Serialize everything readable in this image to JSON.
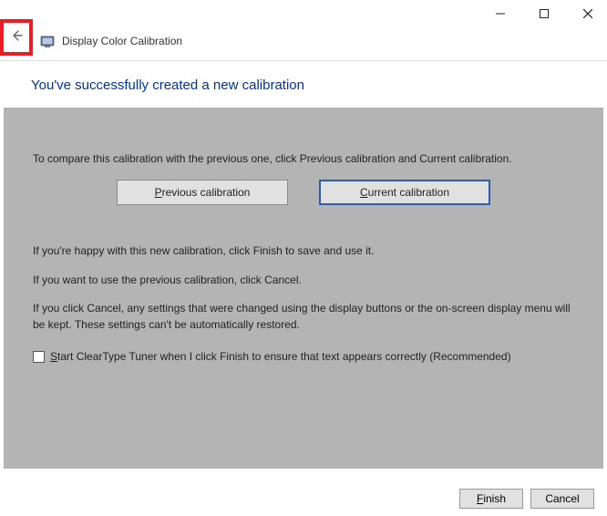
{
  "titlebar": {
    "minimize": "—",
    "maximize": "□",
    "close": "✕"
  },
  "header": {
    "app_title": "Display Color Calibration"
  },
  "heading": "You've successfully created a new calibration",
  "content": {
    "intro": "To compare this calibration with the previous one, click Previous calibration and Current calibration.",
    "prev_btn_prefix": "P",
    "prev_btn_rest": "revious calibration",
    "curr_btn_prefix": "C",
    "curr_btn_rest": "urrent calibration",
    "happy": "If you're happy with this new calibration, click Finish to save and use it.",
    "use_prev": "If you want to use the previous calibration, click Cancel.",
    "cancel_note": "If you click Cancel, any settings that were changed using the display buttons or the on-screen display menu will be kept. These settings can't be automatically restored.",
    "cleartype_prefix": "S",
    "cleartype_rest": "tart ClearType Tuner when I click Finish to ensure that text appears correctly (Recommended)"
  },
  "footer": {
    "finish_prefix": "F",
    "finish_rest": "inish",
    "cancel": "Cancel"
  }
}
